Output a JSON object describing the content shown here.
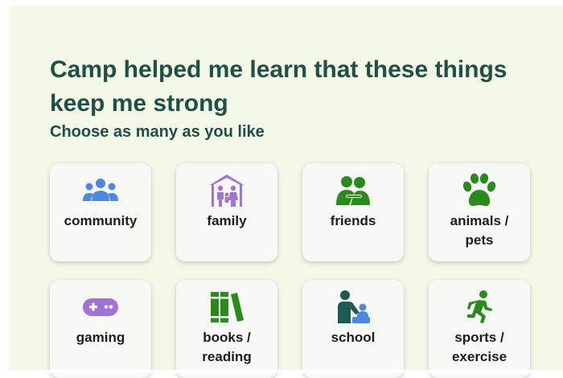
{
  "page": {
    "title": "Camp helped me learn that these things keep me strong",
    "subtitle": "Choose as many as you like"
  },
  "colors": {
    "background": "#f3f8e9",
    "heading": "#1f4f45",
    "card": "#f8f9f7",
    "blue": "#4d88e0",
    "purple": "#9f74d6",
    "green": "#2a8a1d",
    "teal": "#1f5a52"
  },
  "options": [
    {
      "label": "community",
      "icon": "people-group-icon"
    },
    {
      "label": "family",
      "icon": "family-house-icon"
    },
    {
      "label": "friends",
      "icon": "friends-hug-icon"
    },
    {
      "label": "animals /\npets",
      "icon": "paw-icon"
    },
    {
      "label": "gaming",
      "icon": "gamepad-icon"
    },
    {
      "label": "books /\nreading",
      "icon": "books-icon"
    },
    {
      "label": "school",
      "icon": "teacher-icon"
    },
    {
      "label": "sports /\nexercise",
      "icon": "running-icon"
    }
  ]
}
